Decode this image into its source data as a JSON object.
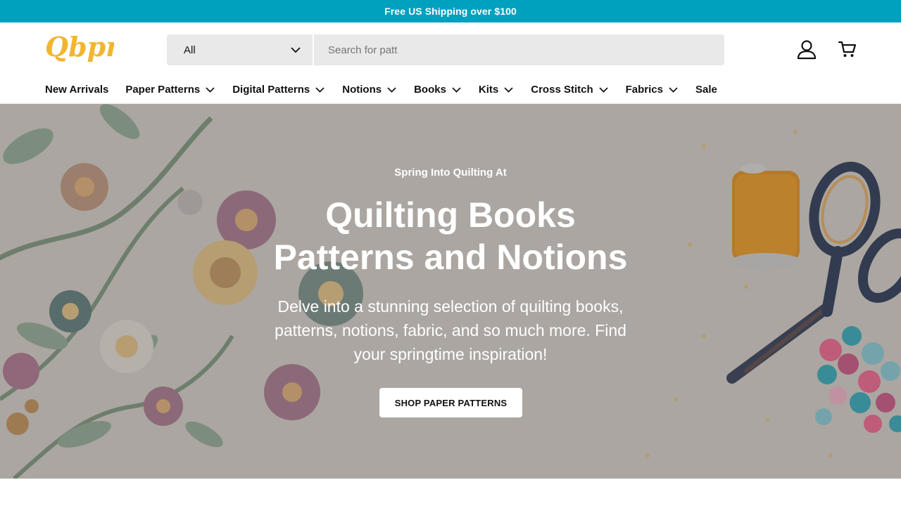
{
  "announcement": {
    "text": "Free US Shipping over $100"
  },
  "logo": {
    "text": "Qbpn",
    "color": "#f2b52f"
  },
  "search": {
    "category": "All",
    "query": "Search for patt",
    "placeholder": "Search for patt"
  },
  "header_icons": {
    "account": "account-icon",
    "cart": "cart-icon"
  },
  "nav": {
    "items": [
      {
        "label": "New Arrivals",
        "dropdown": false
      },
      {
        "label": "Paper Patterns",
        "dropdown": true
      },
      {
        "label": "Digital Patterns",
        "dropdown": true
      },
      {
        "label": "Notions",
        "dropdown": true
      },
      {
        "label": "Books",
        "dropdown": true
      },
      {
        "label": "Kits",
        "dropdown": true
      },
      {
        "label": "Cross Stitch",
        "dropdown": true
      },
      {
        "label": "Fabrics",
        "dropdown": true
      },
      {
        "label": "Sale",
        "dropdown": false
      }
    ]
  },
  "hero": {
    "eyebrow": "Spring Into Quilting At",
    "title_line1": "Quilting Books",
    "title_line2": "Patterns and Notions",
    "description": "Delve into a stunning selection of quilting books, patterns, notions, fabric, and so much more. Find your springtime inspiration!",
    "cta_label": "SHOP PAPER PATTERNS"
  },
  "colors": {
    "accent": "#00a0bf",
    "logo": "#f2b52f",
    "search_bg": "#e9e9e9"
  }
}
